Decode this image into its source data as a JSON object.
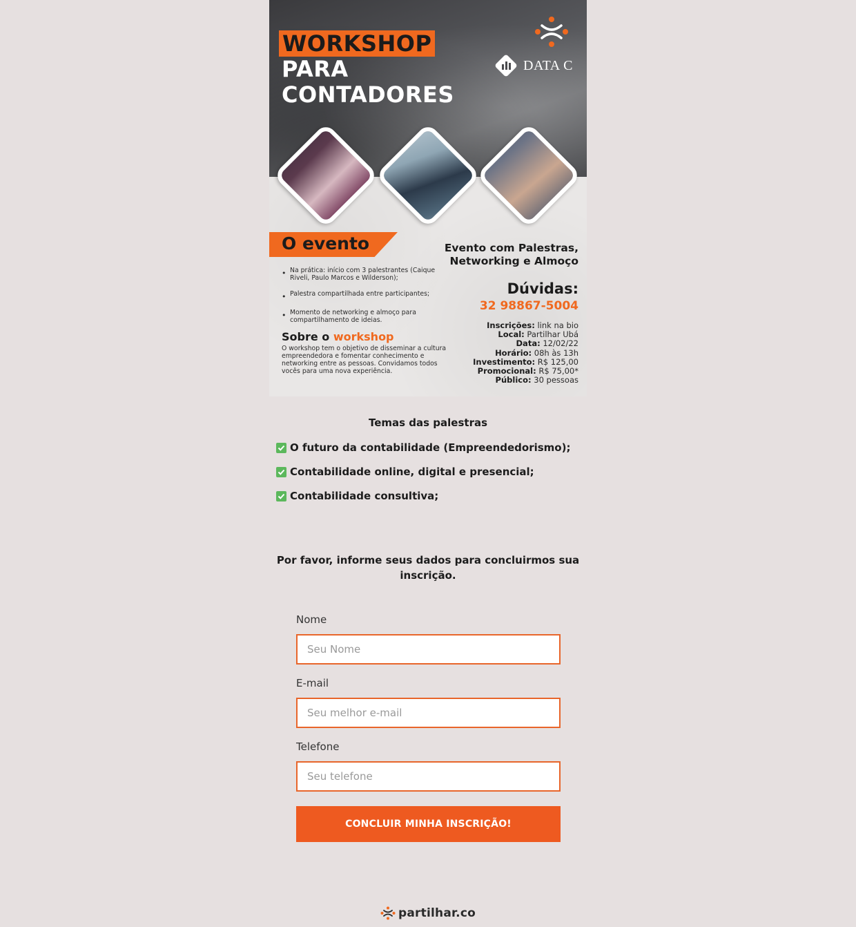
{
  "flyer": {
    "headline": [
      "WORKSHOP",
      "PARA",
      "CONTADORES"
    ],
    "logo_text": "DATA C",
    "evento_tag": "O evento",
    "bullets": [
      "Na prática: início com 3 palestrantes (Caique Riveli, Paulo Marcos e Wilderson);",
      "Palestra compartilhada entre participantes;",
      "Momento de networking e almoço para compartilhamento de ideias."
    ],
    "sobre_prefix": "Sobre o ",
    "sobre_accent": "workshop",
    "sobre_body": "O workshop tem o objetivo de disseminar a cultura empreendedora e fomentar conhecimento e networking entre as pessoas. Convidamos todos vocês para uma nova experiência.",
    "evento_desc": "Evento com Palestras, Networking e Almoço",
    "duvidas": "Dúvidas:",
    "phone": "32 98867-5004",
    "info": [
      {
        "key": "Inscrições:",
        "value": "link na bio"
      },
      {
        "key": "Local:",
        "value": "Partilhar Ubá"
      },
      {
        "key": "Data:",
        "value": "12/02/22"
      },
      {
        "key": "Horário:",
        "value": "08h às 13h"
      },
      {
        "key": "Investimento:",
        "value": "R$ 125,00"
      },
      {
        "key": "Promocional:",
        "value": "R$ 75,00*"
      },
      {
        "key": "Público:",
        "value": "30 pessoas"
      }
    ],
    "accent_color": "#f0691f"
  },
  "temas": {
    "title": "Temas das palestras",
    "items": [
      "O futuro da contabilidade (Empreendedorismo);",
      "Contabilidade online, digital e presencial;",
      "Contabilidade consultiva;"
    ],
    "check_icon": "check-box-icon"
  },
  "prompt": "Por favor, informe seus dados para concluirmos sua inscrição.",
  "form": {
    "name_label": "Nome",
    "name_placeholder": "Seu Nome",
    "email_label": "E-mail",
    "email_placeholder": "Seu melhor e-mail",
    "phone_label": "Telefone",
    "phone_placeholder": "Seu telefone",
    "submit_label": "CONCLUIR MINHA INSCRIÇÃO!",
    "border_color": "#e8652a",
    "button_color": "#ee5a20"
  },
  "footer": {
    "brand": "partilhar.co",
    "icon": "partilhar-logo-icon"
  }
}
